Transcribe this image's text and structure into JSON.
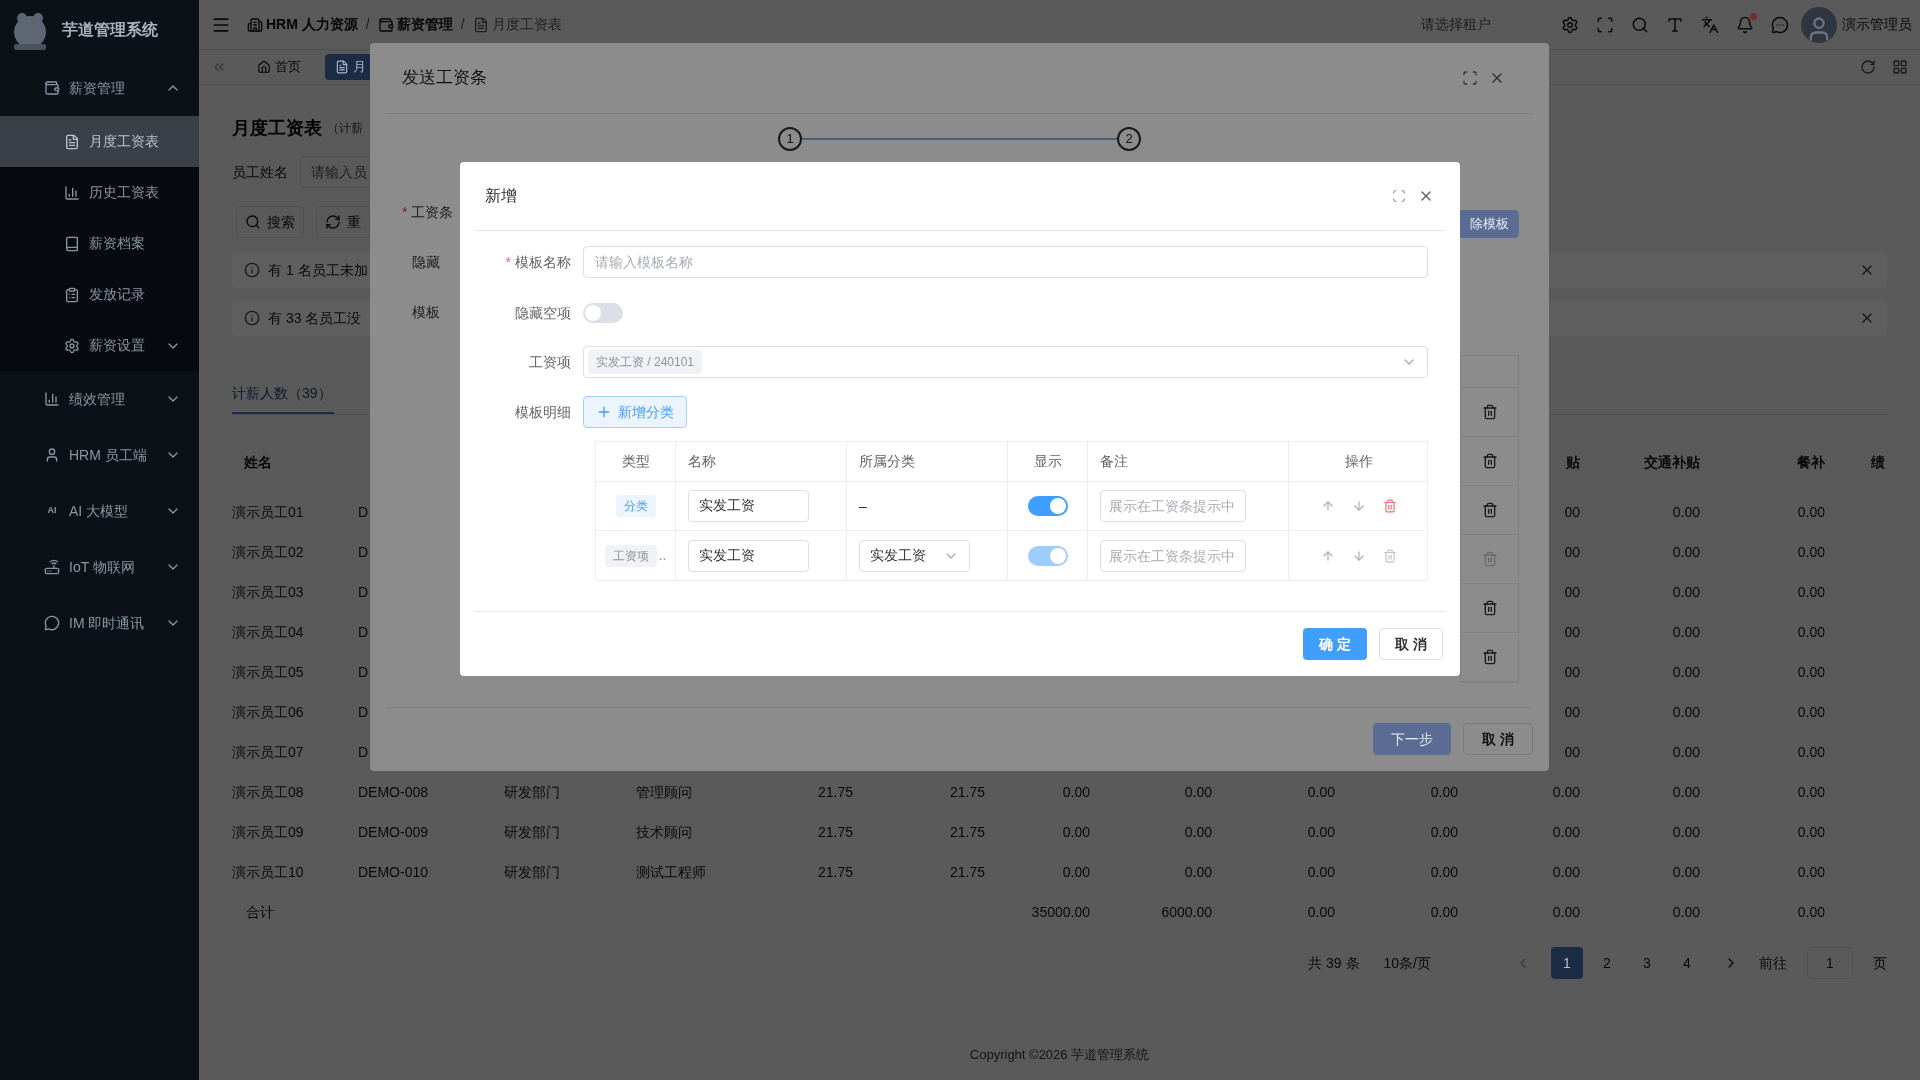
{
  "sidebar": {
    "title": "芋道管理系统",
    "menu": [
      {
        "label": "薪资管理",
        "expanded": true,
        "children": [
          {
            "label": "月度工资表",
            "selected": true
          },
          {
            "label": "历史工资表",
            "selected": false
          },
          {
            "label": "薪资档案",
            "selected": false
          },
          {
            "label": "发放记录",
            "selected": false
          },
          {
            "label": "薪资设置",
            "selected": false,
            "expanded": false
          }
        ]
      },
      {
        "label": "绩效管理",
        "expanded": false
      },
      {
        "label": "HRM 员工端",
        "expanded": false
      },
      {
        "label": "AI 大模型",
        "icon_text": "AI",
        "expanded": false
      },
      {
        "label": "IoT 物联网",
        "expanded": false
      },
      {
        "label": "IM 即时通讯",
        "expanded": false
      }
    ]
  },
  "header": {
    "breadcrumb": [
      {
        "label": "HRM 人力资源"
      },
      {
        "separator": "/",
        "label": "薪资管理"
      },
      {
        "separator": "/",
        "label": "月度工资表"
      }
    ],
    "tenant_placeholder": "请选择租户",
    "unread": true,
    "user": "演示管理员"
  },
  "tags": [
    {
      "label": "首页",
      "selected": false
    },
    {
      "label": "月",
      "selected": true
    }
  ],
  "page": {
    "title": "月度工资表",
    "subtitle": "（计薪",
    "search": {
      "label": "员工姓名",
      "placeholder": "请输入员"
    },
    "buttons": [
      "搜索",
      "重"
    ],
    "alerts": [
      "有 1 名员工未加",
      "有 33 名员工没"
    ],
    "tabs": [
      {
        "label": "计薪人数（39）",
        "selected": true
      }
    ],
    "table": {
      "header": {
        "name": "姓名",
        "column_11": "贴",
        "column_12": "交通补贴",
        "column_13": "餐补",
        "column_14": "绩"
      },
      "rows": [
        {
          "kind": "data",
          "name": "演示员工01",
          "code": "D",
          "column_11": "00",
          "column_12": "0.00",
          "column_13": "0.00"
        },
        {
          "kind": "data",
          "name": "演示员工02",
          "code": "D",
          "column_11": "00",
          "column_12": "0.00",
          "column_13": "0.00"
        },
        {
          "kind": "data",
          "name": "演示员工03",
          "code": "D",
          "column_11": "00",
          "column_12": "0.00",
          "column_13": "0.00"
        },
        {
          "kind": "data",
          "name": "演示员工04",
          "code": "D",
          "column_11": "00",
          "column_12": "0.00",
          "column_13": "0.00"
        },
        {
          "kind": "data",
          "name": "演示员工05",
          "code": "D",
          "column_11": "00",
          "column_12": "0.00",
          "column_13": "0.00"
        },
        {
          "kind": "data",
          "name": "演示员工06",
          "code": "D",
          "column_11": "00",
          "column_12": "0.00",
          "column_13": "0.00"
        },
        {
          "kind": "data",
          "name": "演示员工07",
          "code": "D",
          "column_11": "00",
          "column_12": "0.00",
          "column_13": "0.00"
        },
        {
          "kind": "data",
          "name": "演示员工08",
          "code": "DEMO-008",
          "department": "研发部门",
          "position": "管理顾问",
          "column_5": "21.75",
          "column_6": "21.75",
          "column_7": "0.00",
          "column_8": "0.00",
          "column_9": "0.00",
          "column_10": "0.00",
          "column_11": "0.00",
          "column_12": "0.00",
          "column_13": "0.00"
        },
        {
          "kind": "data",
          "name": "演示员工09",
          "code": "DEMO-009",
          "department": "研发部门",
          "position": "技术顾问",
          "column_5": "21.75",
          "column_6": "21.75",
          "column_7": "0.00",
          "column_8": "0.00",
          "column_9": "0.00",
          "column_10": "0.00",
          "column_11": "0.00",
          "column_12": "0.00",
          "column_13": "0.00"
        },
        {
          "kind": "data",
          "name": "演示员工10",
          "code": "DEMO-010",
          "department": "研发部门",
          "position": "测试工程师",
          "column_5": "21.75",
          "column_6": "21.75",
          "column_7": "0.00",
          "column_8": "0.00",
          "column_9": "0.00",
          "column_10": "0.00",
          "column_11": "0.00",
          "column_12": "0.00",
          "column_13": "0.00"
        },
        {
          "kind": "total",
          "name": "合计",
          "column_7": "35000.00",
          "column_8": "6000.00",
          "column_9": "0.00",
          "column_10": "0.00",
          "column_11": "0.00",
          "column_12": "0.00",
          "column_13": "0.00"
        }
      ]
    },
    "pagination": {
      "total": "共 39 条",
      "page_size": "10条/页",
      "pages": [
        {
          "label": "1",
          "selected": true
        },
        {
          "label": "2",
          "selected": false
        },
        {
          "label": "3",
          "selected": false
        },
        {
          "label": "4",
          "selected": false
        }
      ],
      "goto": "前往",
      "goto_value": "1",
      "goto_suffix": "页"
    },
    "footer": "Copyright ©2026 芋道管理系统"
  },
  "send_dialog": {
    "title": "发送工资条",
    "steps": [
      "1",
      "2"
    ],
    "labels": [
      {
        "mark": "*",
        "text": "工资条"
      },
      {
        "text": "隐藏"
      },
      {
        "text": "模板"
      }
    ],
    "side_button": "除模板",
    "table_rows": [
      {
        "disabled": false
      },
      {
        "disabled": false
      },
      {
        "disabled": false
      },
      {
        "disabled": true
      },
      {
        "disabled": false
      },
      {
        "disabled": false
      }
    ],
    "buttons": [
      {
        "label": "下一步",
        "kind": "primary"
      },
      {
        "label": "取 消",
        "kind": "default"
      }
    ]
  },
  "add_dialog": {
    "title": "新增",
    "name_field": {
      "mark": "*",
      "label": "模板名称",
      "placeholder": "请输入模板名称"
    },
    "hide_empty": {
      "label": "隐藏空项",
      "on": false
    },
    "items_field": {
      "label": "工资项",
      "tags": [
        "实发工资 / 240101"
      ]
    },
    "detail": {
      "label": "模板明细",
      "add_button": "新增分类"
    },
    "columns": [
      "类型",
      "名称",
      "所属分类",
      "显示",
      "备注",
      "操作"
    ],
    "rows": [
      {
        "type": "分类",
        "kind": "category",
        "name": "实发工资",
        "category": "–",
        "show": true,
        "remark_placeholder": "展示在工资条提示中",
        "locked": false
      },
      {
        "type": "工资项",
        "kind": "item",
        "overflow": "..",
        "name": "实发工资",
        "category": "实发工资",
        "show": true,
        "remark_placeholder": "展示在工资条提示中",
        "locked": true
      }
    ],
    "buttons": [
      {
        "label": "确 定",
        "kind": "primary"
      },
      {
        "label": "取 消",
        "kind": "default"
      }
    ]
  }
}
